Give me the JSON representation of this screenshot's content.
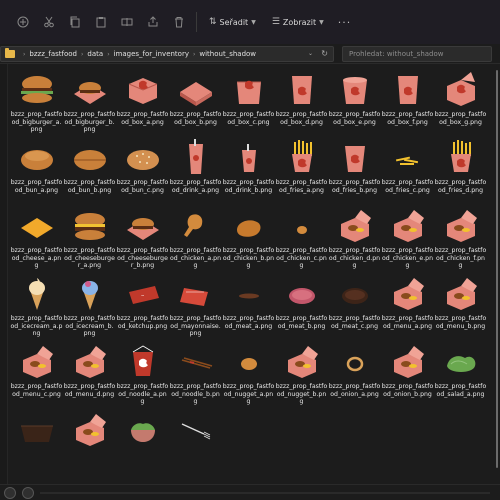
{
  "toolbar": {
    "sort_label": "Seřadit",
    "view_label": "Zobrazit",
    "more": "···",
    "icons": [
      "new-icon",
      "cut-icon",
      "copy-icon",
      "paste-icon",
      "rename-icon",
      "share-icon",
      "delete-icon",
      "sort-icon",
      "view-icon"
    ]
  },
  "address": {
    "breadcrumbs": [
      "bzzz_fastfood",
      "data",
      "images_for_inventory",
      "without_shadow"
    ],
    "chevron": "⌄",
    "refresh": "↻"
  },
  "search": {
    "placeholder": "Prohledat: without_shadow"
  },
  "files": [
    {
      "name": "bzzz_prop_fastfood_bigburger_a.png",
      "icon": "burger"
    },
    {
      "name": "bzzz_prop_fastfood_bigburger_b.png",
      "icon": "burger-box"
    },
    {
      "name": "bzzz_prop_fastfood_box_a.png",
      "icon": "box-closed"
    },
    {
      "name": "bzzz_prop_fastfood_box_b.png",
      "icon": "box-flat"
    },
    {
      "name": "bzzz_prop_fastfood_box_c.png",
      "icon": "box-clam"
    },
    {
      "name": "bzzz_prop_fastfood_box_d.png",
      "icon": "box-chicken"
    },
    {
      "name": "bzzz_prop_fastfood_box_e.png",
      "icon": "box-tub"
    },
    {
      "name": "bzzz_prop_fastfood_box_f.png",
      "icon": "box-chicken"
    },
    {
      "name": "bzzz_prop_fastfood_box_g.png",
      "icon": "box-open"
    },
    {
      "name": "bzzz_prop_fastfood_bun_a.png",
      "icon": "bun"
    },
    {
      "name": "bzzz_prop_fastfood_bun_b.png",
      "icon": "bun-bottom"
    },
    {
      "name": "bzzz_prop_fastfood_bun_c.png",
      "icon": "bun-seeded"
    },
    {
      "name": "bzzz_prop_fastfood_drink_a.png",
      "icon": "drink-tall"
    },
    {
      "name": "bzzz_prop_fastfood_drink_b.png",
      "icon": "drink-short"
    },
    {
      "name": "bzzz_prop_fastfood_fries_a.png",
      "icon": "fries"
    },
    {
      "name": "bzzz_prop_fastfood_fries_b.png",
      "icon": "fries-box"
    },
    {
      "name": "bzzz_prop_fastfood_fries_c.png",
      "icon": "fries-loose"
    },
    {
      "name": "bzzz_prop_fastfood_fries_d.png",
      "icon": "fries"
    },
    {
      "name": "bzzz_prop_fastfood_cheese_a.png",
      "icon": "cheese"
    },
    {
      "name": "bzzz_prop_fastfood_cheeseburger_a.png",
      "icon": "cheeseburger"
    },
    {
      "name": "bzzz_prop_fastfood_cheeseburger_b.png",
      "icon": "burger-box"
    },
    {
      "name": "bzzz_prop_fastfood_chicken_a.png",
      "icon": "drumstick"
    },
    {
      "name": "bzzz_prop_fastfood_chicken_b.png",
      "icon": "chicken-piece"
    },
    {
      "name": "bzzz_prop_fastfood_chicken_c.png",
      "icon": "nugget-small"
    },
    {
      "name": "bzzz_prop_fastfood_chicken_d.png",
      "icon": "box-food"
    },
    {
      "name": "bzzz_prop_fastfood_chicken_e.png",
      "icon": "box-food"
    },
    {
      "name": "bzzz_prop_fastfood_chicken_f.png",
      "icon": "box-food"
    },
    {
      "name": "bzzz_prop_fastfood_icecream_a.png",
      "icon": "icecream-vanilla"
    },
    {
      "name": "bzzz_prop_fastfood_icecream_b.png",
      "icon": "icecream-berry"
    },
    {
      "name": "bzzz_prop_fastfood_ketchup.png",
      "icon": "ketchup"
    },
    {
      "name": "bzzz_prop_fastfood_mayonnaise.png",
      "icon": "mayo"
    },
    {
      "name": "bzzz_prop_fastfood_meat_a.png",
      "icon": "meat-thin"
    },
    {
      "name": "bzzz_prop_fastfood_meat_b.png",
      "icon": "meat-raw"
    },
    {
      "name": "bzzz_prop_fastfood_meat_c.png",
      "icon": "meat-cooked"
    },
    {
      "name": "bzzz_prop_fastfood_menu_a.png",
      "icon": "box-food"
    },
    {
      "name": "bzzz_prop_fastfood_menu_b.png",
      "icon": "box-food"
    },
    {
      "name": "bzzz_prop_fastfood_menu_c.png",
      "icon": "box-food"
    },
    {
      "name": "bzzz_prop_fastfood_menu_d.png",
      "icon": "box-food"
    },
    {
      "name": "bzzz_prop_fastfood_noodle_a.png",
      "icon": "noodle-box"
    },
    {
      "name": "bzzz_prop_fastfood_noodle_b.png",
      "icon": "chopsticks"
    },
    {
      "name": "bzzz_prop_fastfood_nugget_a.png",
      "icon": "nugget"
    },
    {
      "name": "bzzz_prop_fastfood_nugget_b.png",
      "icon": "box-food"
    },
    {
      "name": "bzzz_prop_fastfood_onion_a.png",
      "icon": "onion-ring"
    },
    {
      "name": "bzzz_prop_fastfood_onion_b.png",
      "icon": "box-food"
    },
    {
      "name": "bzzz_prop_fastfood_salad_a.png",
      "icon": "salad"
    },
    {
      "name": "",
      "icon": "tray"
    },
    {
      "name": "",
      "icon": "box-food"
    },
    {
      "name": "",
      "icon": "salad-bowl"
    },
    {
      "name": "",
      "icon": "fork"
    }
  ],
  "colors": {
    "box": "#e4877a",
    "box_dark": "#b8574c",
    "logo_red": "#c0392b",
    "bun": "#c9803a",
    "fries": "#f2c12e",
    "folder": "#e8b84a"
  }
}
